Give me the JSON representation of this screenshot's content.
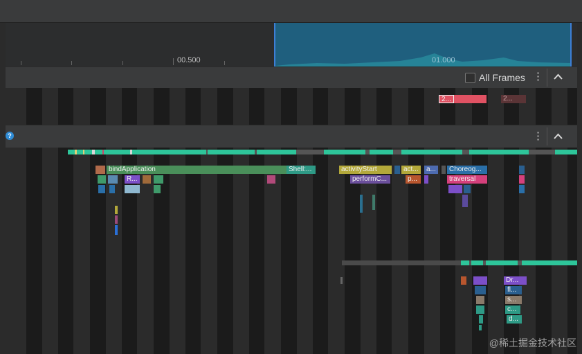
{
  "timeline": {
    "tick_labels": [
      "00.500",
      "01.000"
    ]
  },
  "frames": {
    "all_frames_label": "All Frames",
    "frame_labels": [
      "2...",
      "2..."
    ]
  },
  "thread": {
    "help_icon": "?",
    "slices": {
      "bind_application": "bindApplication",
      "shell": "Shell:...",
      "activity_start": "activityStart",
      "act": "act...",
      "a": "a...",
      "choreog": "Choreog...",
      "r": "R...",
      "perform_c": "performC...",
      "p": "p...",
      "traversal": "traversal",
      "dr": "Dr...",
      "fl": "fl...",
      "s": "s...",
      "c": "c...",
      "d": "d..."
    }
  },
  "icons": [
    "more-vert-icon",
    "collapse-up-icon",
    "help-icon",
    "checkbox-icon"
  ],
  "watermark": "@稀土掘金技术社区",
  "colors": {
    "selection": "#1f5f7e",
    "teal_bar": "#2ec59a",
    "green_slice": "#4a8f5a",
    "yellow_slice": "#b3a83a",
    "pink_slice": "#d5407c",
    "purple_slice": "#7c4fc8",
    "frame_red": "#e05263"
  }
}
